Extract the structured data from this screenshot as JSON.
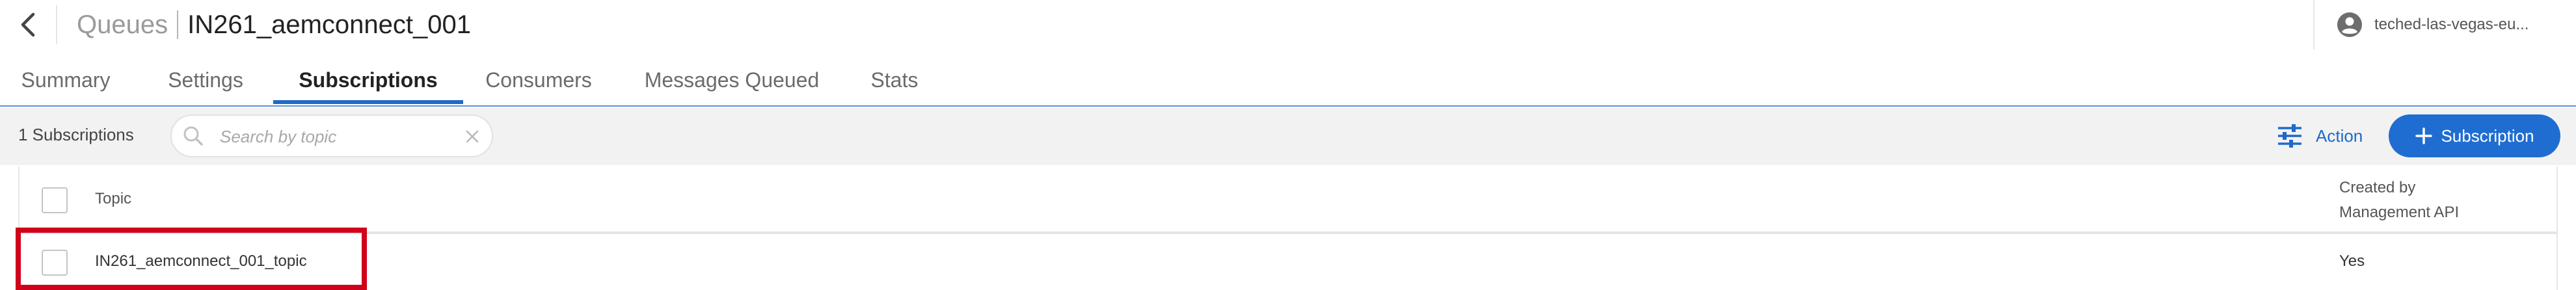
{
  "header": {
    "back_icon": "chevron-left-icon",
    "breadcrumb_parent": "Queues",
    "title": "IN261_aemconnect_001",
    "account_icon": "user-circle-icon",
    "account_name": "teched-las-vegas-eu..."
  },
  "tabs": [
    {
      "label": "Summary",
      "active": false
    },
    {
      "label": "Settings",
      "active": false
    },
    {
      "label": "Subscriptions",
      "active": true
    },
    {
      "label": "Consumers",
      "active": false
    },
    {
      "label": "Messages Queued",
      "active": false
    },
    {
      "label": "Stats",
      "active": false
    }
  ],
  "toolbar": {
    "count_label": "1 Subscriptions",
    "search": {
      "placeholder": "Search by topic",
      "value": "",
      "icon": "search-icon",
      "clear_icon": "close-icon"
    },
    "action_label": "Action",
    "action_icon": "sliders-icon",
    "add_label": "Subscription",
    "add_icon": "plus-icon"
  },
  "table": {
    "columns": {
      "topic": "Topic",
      "created_line1": "Created by",
      "created_line2": "Management API"
    },
    "rows": [
      {
        "topic": "IN261_aemconnect_001_topic",
        "created": "Yes"
      }
    ]
  },
  "colors": {
    "accent": "#1e6ac9",
    "button_bg": "#1f6dd1",
    "highlight": "#d0021b",
    "toolbar_bg": "#f2f2f2"
  }
}
